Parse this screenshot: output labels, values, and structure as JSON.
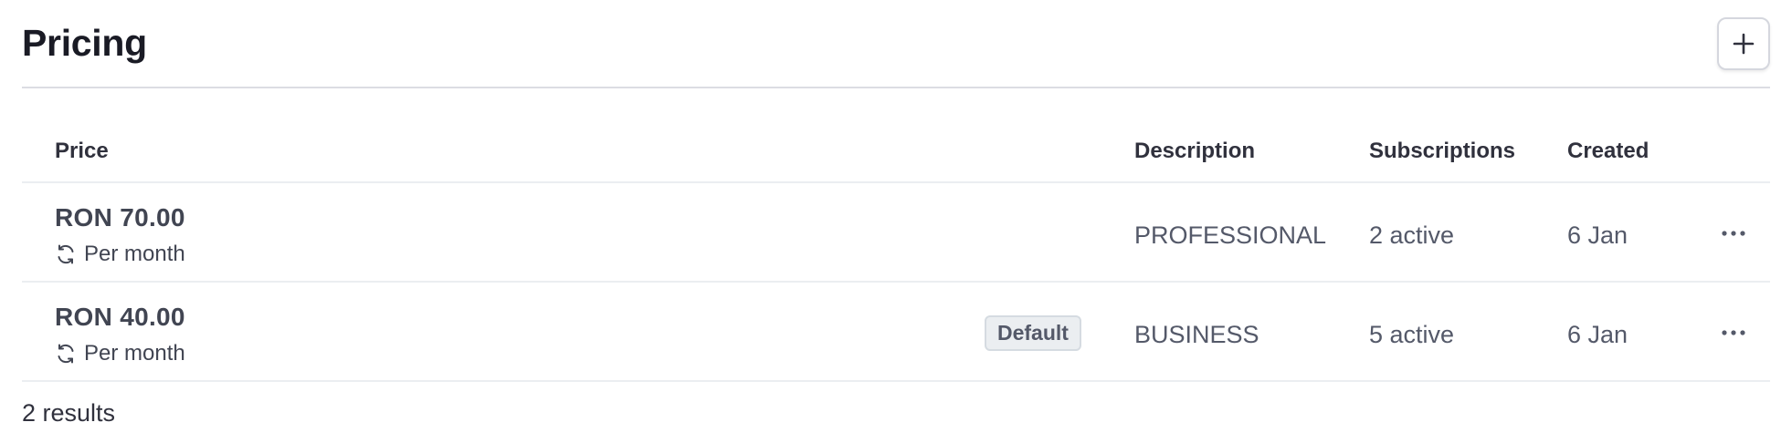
{
  "header": {
    "title": "Pricing",
    "add_icon": "plus-icon"
  },
  "table": {
    "columns": {
      "price": "Price",
      "description": "Description",
      "subscriptions": "Subscriptions",
      "created": "Created"
    },
    "rows": [
      {
        "amount": "RON 70.00",
        "interval": "Per month",
        "interval_icon": "recurring-icon",
        "badge": "",
        "description": "PROFESSIONAL",
        "subscriptions": "2 active",
        "created": "6 Jan",
        "menu_icon": "more-horizontal-icon"
      },
      {
        "amount": "RON 40.00",
        "interval": "Per month",
        "interval_icon": "recurring-icon",
        "badge": "Default",
        "description": "BUSINESS",
        "subscriptions": "5 active",
        "created": "6 Jan",
        "menu_icon": "more-horizontal-icon"
      }
    ]
  },
  "footer": {
    "results": "2 results"
  },
  "colors": {
    "text_primary": "#1a1b25",
    "text_secondary": "#545969",
    "border": "#ebeef1",
    "badge_bg": "#ebeef1"
  }
}
